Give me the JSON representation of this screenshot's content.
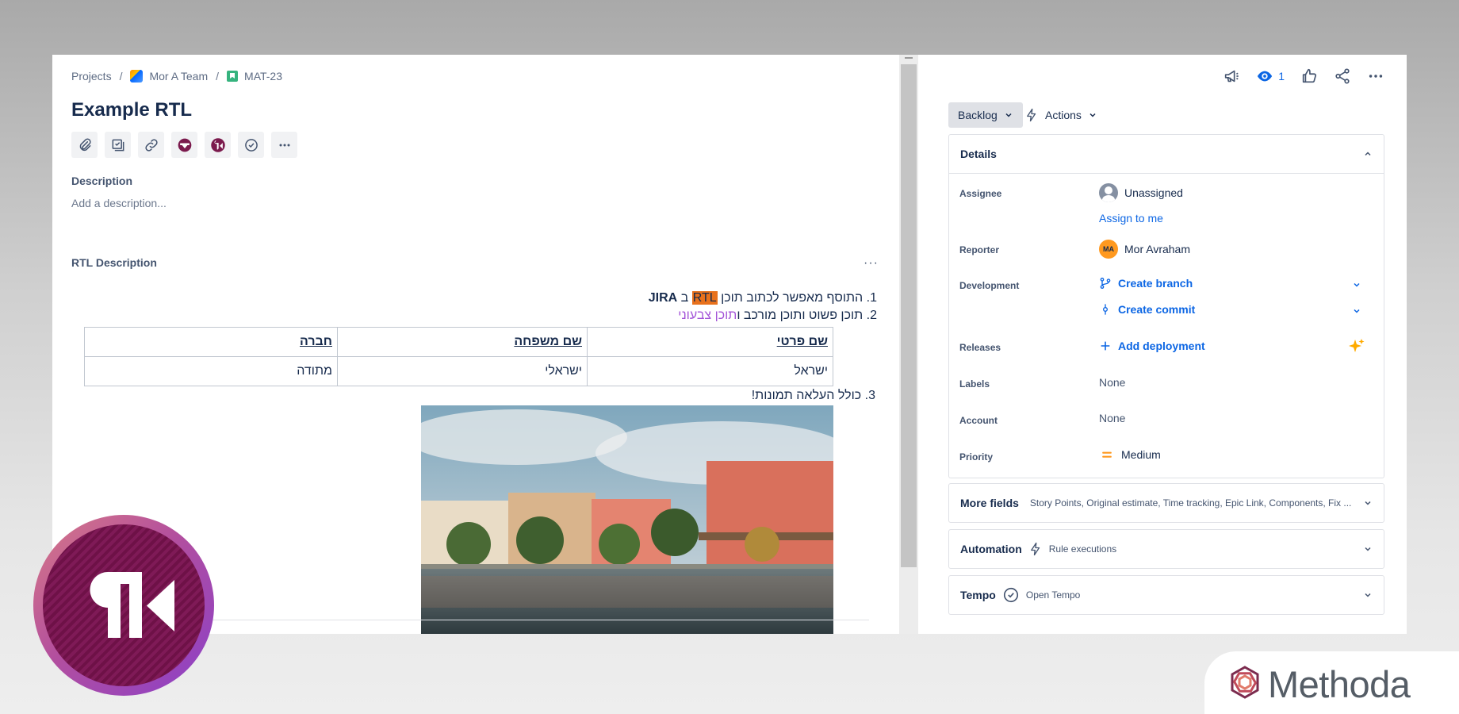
{
  "breadcrumb": {
    "projects": "Projects",
    "project_name": "Mor A Team",
    "issue_key": "MAT-23",
    "separator": "/"
  },
  "issue": {
    "title": "Example RTL"
  },
  "description": {
    "label": "Description",
    "placeholder": "Add a description..."
  },
  "rtl_description": {
    "label": "RTL Description",
    "more": "···",
    "line1": {
      "num": "1.",
      "text": "התוסף מאפשר לכתוב תוכן ",
      "highlight": "RTL",
      "mid": " ב ",
      "bold": "JIRA"
    },
    "line2": {
      "num": "2.",
      "plain": "תוכן פשוט ותוכן מורכב ו",
      "colored": "תוכן צבעוני"
    },
    "table": {
      "headers": [
        "שם פרטי",
        "שם משפחה",
        "חברה"
      ],
      "rows": [
        [
          "ישראל",
          "ישראלי",
          "מתודה"
        ]
      ]
    },
    "line3": {
      "num": "3.",
      "text": "כולל העלאה תמונות!"
    }
  },
  "right": {
    "watch_count": "1",
    "status": "Backlog",
    "actions": "Actions",
    "details": {
      "title": "Details",
      "assignee_label": "Assignee",
      "assignee_value": "Unassigned",
      "assign_to_me": "Assign to me",
      "reporter_label": "Reporter",
      "reporter_initials": "MA",
      "reporter_value": "Mor Avraham",
      "development_label": "Development",
      "create_branch": "Create branch",
      "create_commit": "Create commit",
      "releases_label": "Releases",
      "add_deployment": "Add deployment",
      "labels_label": "Labels",
      "labels_value": "None",
      "account_label": "Account",
      "account_value": "None",
      "priority_label": "Priority",
      "priority_value": "Medium"
    },
    "more_fields": {
      "title": "More fields",
      "sub": "Story Points, Original estimate, Time tracking, Epic Link, Components, Fix ..."
    },
    "automation": {
      "title": "Automation",
      "sub": "Rule executions"
    },
    "tempo": {
      "title": "Tempo",
      "sub": "Open Tempo"
    }
  },
  "branding": {
    "methoda": "Methoda"
  },
  "colors": {
    "accent": "#0c66e4",
    "highlight": "#e8711c",
    "purple_text": "#a455d8",
    "logo_purple": "#6e1147"
  }
}
